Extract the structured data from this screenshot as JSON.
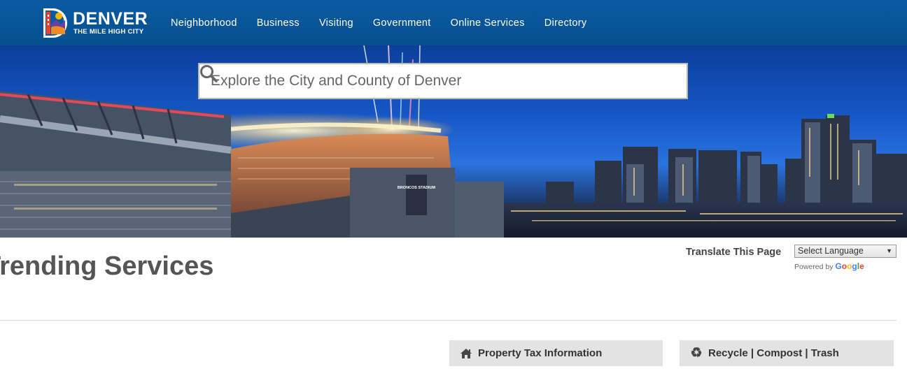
{
  "header": {
    "logo_word": "DENVER",
    "logo_tagline": "THE MILE HIGH CITY",
    "nav": [
      {
        "label": "Neighborhood"
      },
      {
        "label": "Business"
      },
      {
        "label": "Visiting"
      },
      {
        "label": "Government"
      },
      {
        "label": "Online Services"
      },
      {
        "label": "Directory"
      }
    ]
  },
  "hero": {
    "search_placeholder": "Explore the City and County of Denver",
    "search_icon": "search-icon",
    "stadium_sign": "BRONCOS STADIUM"
  },
  "main": {
    "section_title": "Trending Services",
    "translate": {
      "label": "Translate This Page",
      "select_value": "Select Language",
      "powered_by": "Powered by",
      "google": [
        "G",
        "o",
        "o",
        "g",
        "l",
        "e"
      ]
    },
    "services": [
      {
        "label": "Property Tax Information",
        "icon": "home-icon"
      },
      {
        "label": "Recycle | Compost | Trash",
        "icon": "recycle-icon"
      }
    ]
  },
  "colors": {
    "nav_bg": "#0a5aa2",
    "card_bg": "#e3e3e3",
    "title_text": "#555555"
  }
}
